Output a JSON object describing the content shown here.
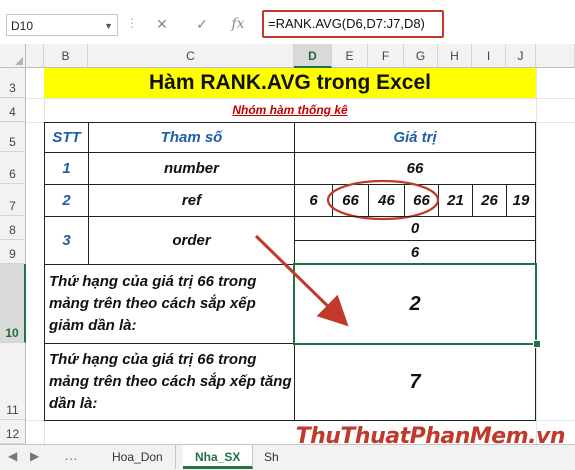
{
  "formula_bar": {
    "name_box": "D10",
    "cancel_glyph": "✕",
    "enter_glyph": "✓",
    "fx_label": "fx",
    "formula": "=RANK.AVG(D6,D7:J7,D8)"
  },
  "columns": [
    "B",
    "C",
    "D",
    "E",
    "F",
    "G",
    "H",
    "I",
    "J"
  ],
  "rows": [
    "3",
    "4",
    "5",
    "6",
    "7",
    "8",
    "9",
    "10",
    "11",
    "12"
  ],
  "sheet": {
    "title": "Hàm RANK.AVG trong Excel",
    "subtitle": "Nhóm hàm thống kê",
    "header": {
      "stt": "STT",
      "param": "Tham số",
      "value": "Giá trị"
    },
    "row1": {
      "stt": "1",
      "param": "number",
      "value": "66"
    },
    "row2": {
      "stt": "2",
      "param": "ref",
      "values": [
        "6",
        "66",
        "46",
        "66",
        "21",
        "26",
        "19"
      ]
    },
    "row3": {
      "stt": "3",
      "param": "order",
      "value_a": "0",
      "value_b": "6"
    },
    "desc_desc": {
      "label": "Thứ hạng của giá trị 66 trong mảng trên theo cách sắp xếp giảm dần là:",
      "result": "2"
    },
    "desc_asc": {
      "label": "Thứ hạng của giá trị 66 trong mảng trên theo cách sắp xếp tăng dần là:",
      "result": "7"
    }
  },
  "tabs": {
    "items": [
      "Hoa_Don",
      "Nha_SX",
      "Sh"
    ],
    "active": "Nha_SX"
  },
  "watermark": "ThuThuatPhanMem.vn",
  "colors": {
    "accent": "#217346",
    "title_bg": "#ffff00",
    "highlight": "#c0392b",
    "blue_text": "#1f5ea8"
  }
}
